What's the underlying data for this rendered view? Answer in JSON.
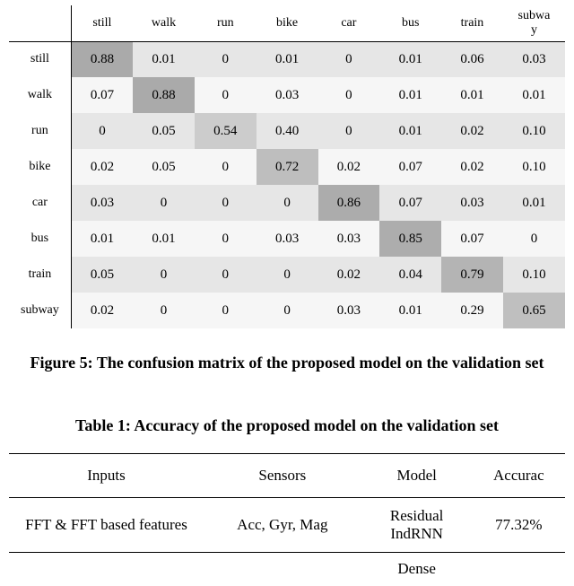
{
  "chart_data": {
    "type": "heatmap",
    "labels": [
      "still",
      "walk",
      "run",
      "bike",
      "car",
      "bus",
      "train",
      "subway"
    ],
    "col_header_split": {
      "index": 7,
      "line1": "subwa",
      "line2": "y"
    },
    "matrix": [
      [
        0.88,
        0.01,
        0,
        0.01,
        0,
        0.01,
        0.06,
        0.03
      ],
      [
        0.07,
        0.88,
        0,
        0.03,
        0,
        0.01,
        0.01,
        0.01
      ],
      [
        0,
        0.05,
        0.54,
        0.4,
        0,
        0.01,
        0.02,
        0.1
      ],
      [
        0.02,
        0.05,
        0,
        0.72,
        0.02,
        0.07,
        0.02,
        0.1
      ],
      [
        0.03,
        0,
        0,
        0,
        0.86,
        0.07,
        0.03,
        0.01
      ],
      [
        0.01,
        0.01,
        0,
        0.03,
        0.03,
        0.85,
        0.07,
        0
      ],
      [
        0.05,
        0,
        0,
        0,
        0.02,
        0.04,
        0.79,
        0.1
      ],
      [
        0.02,
        0,
        0,
        0,
        0.03,
        0.01,
        0.29,
        0.65
      ]
    ],
    "display": [
      [
        "0.88",
        "0.01",
        "0",
        "0.01",
        "0",
        "0.01",
        "0.06",
        "0.03"
      ],
      [
        "0.07",
        "0.88",
        "0",
        "0.03",
        "0",
        "0.01",
        "0.01",
        "0.01"
      ],
      [
        "0",
        "0.05",
        "0.54",
        "0.40",
        "0",
        "0.01",
        "0.02",
        "0.10"
      ],
      [
        "0.02",
        "0.05",
        "0",
        "0.72",
        "0.02",
        "0.07",
        "0.02",
        "0.10"
      ],
      [
        "0.03",
        "0",
        "0",
        "0",
        "0.86",
        "0.07",
        "0.03",
        "0.01"
      ],
      [
        "0.01",
        "0.01",
        "0",
        "0.03",
        "0.03",
        "0.85",
        "0.07",
        "0"
      ],
      [
        "0.05",
        "0",
        "0",
        "0",
        "0.02",
        "0.04",
        "0.79",
        "0.10"
      ],
      [
        "0.02",
        "0",
        "0",
        "0",
        "0.03",
        "0.01",
        "0.29",
        "0.65"
      ]
    ],
    "row_base_colors": [
      "#e6e6e6",
      "#f6f6f6",
      "#e6e6e6",
      "#f6f6f6",
      "#e6e6e6",
      "#f6f6f6",
      "#e6e6e6",
      "#f6f6f6"
    ],
    "diag_colors": [
      "#aaaaaa",
      "#aaaaaa",
      "#cccccc",
      "#bebebe",
      "#acacac",
      "#adadad",
      "#b4b4b4",
      "#bfbfbf"
    ]
  },
  "figure_caption": "Figure 5: The confusion matrix of the proposed model on the validation set",
  "table_caption": "Table 1: Accuracy of the proposed model on the validation set",
  "acc_table": {
    "headers": [
      "Inputs",
      "Sensors",
      "Model",
      "Accurac"
    ],
    "row1": {
      "inputs": "FFT & FFT based features",
      "sensors": "Acc, Gyr, Mag",
      "model_line1": "Residual",
      "model_line2": "IndRNN",
      "accuracy": "77.32%"
    },
    "partial_next_model": "Dense"
  }
}
